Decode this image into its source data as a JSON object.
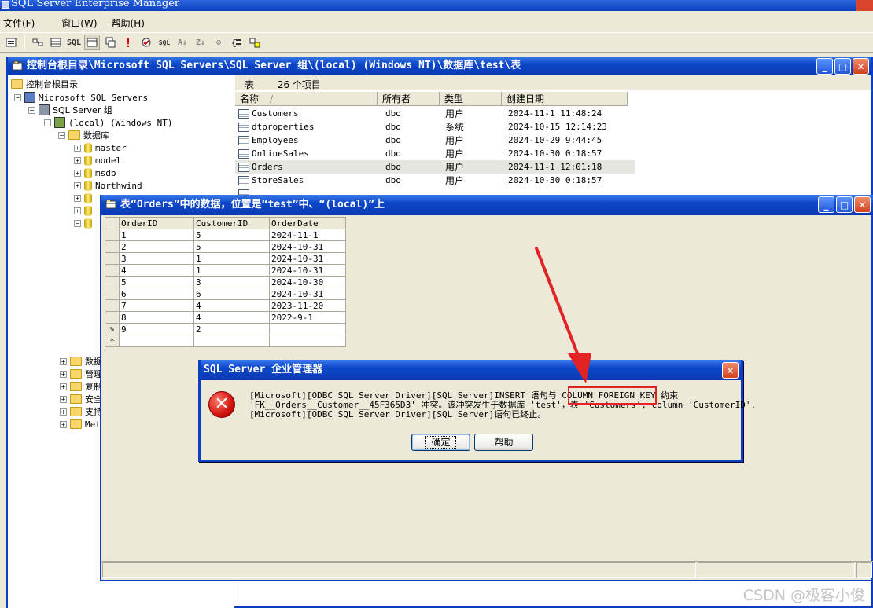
{
  "app": {
    "title": "SQL Server Enterprise Manager"
  },
  "menu": [
    "文件(F)",
    "窗口(W)",
    "帮助(H)"
  ],
  "console": {
    "title": "控制台根目录\\Microsoft SQL Servers\\SQL Server 组\\(local) (Windows NT)\\数据库\\test\\表"
  },
  "tree": {
    "root": "控制台根目录",
    "ms_servers": "Microsoft SQL Servers",
    "group": "SQL Server 组",
    "server": "(local) (Windows NT)",
    "databases": "数据库",
    "dbs": [
      "master",
      "model",
      "msdb",
      "Northwind"
    ],
    "more_folders": [
      "数据",
      "管理",
      "复制",
      "安全",
      "支持",
      "Met"
    ]
  },
  "list": {
    "summary_label": "表",
    "summary_count": "26 个项目",
    "columns": [
      "名称",
      "所有者",
      "类型",
      "创建日期"
    ],
    "rows": [
      {
        "name": "Customers",
        "owner": "dbo",
        "type": "用户",
        "created": "2024-11-1 11:48:24"
      },
      {
        "name": "dtproperties",
        "owner": "dbo",
        "type": "系统",
        "created": "2024-10-15 12:14:23"
      },
      {
        "name": "Employees",
        "owner": "dbo",
        "type": "用户",
        "created": "2024-10-29 9:44:45"
      },
      {
        "name": "OnlineSales",
        "owner": "dbo",
        "type": "用户",
        "created": "2024-10-30 0:18:57"
      },
      {
        "name": "Orders",
        "owner": "dbo",
        "type": "用户",
        "created": "2024-11-1 12:01:18"
      },
      {
        "name": "StoreSales",
        "owner": "dbo",
        "type": "用户",
        "created": "2024-10-30 0:18:57"
      }
    ]
  },
  "data_window": {
    "title": "表“Orders”中的数据，位置是“test”中、“(local)”上",
    "columns": [
      "OrderID",
      "CustomerID",
      "OrderDate"
    ],
    "rows": [
      [
        "1",
        "5",
        "2024-11-1"
      ],
      [
        "2",
        "5",
        "2024-10-31"
      ],
      [
        "3",
        "1",
        "2024-10-31"
      ],
      [
        "4",
        "1",
        "2024-10-31"
      ],
      [
        "5",
        "3",
        "2024-10-30"
      ],
      [
        "6",
        "6",
        "2024-10-31"
      ],
      [
        "7",
        "4",
        "2023-11-20"
      ],
      [
        "8",
        "4",
        "2022-9-1"
      ],
      [
        "9",
        "2",
        ""
      ]
    ],
    "new_row_marker": "*"
  },
  "error_dialog": {
    "title": "SQL Server 企业管理器",
    "line1": "[Microsoft][ODBC SQL Server Driver][SQL Server]INSERT 语句与 COLUMN FOREIGN KEY 约束",
    "line2": "'FK__Orders__Customer__45F365D3' 冲突。该冲突发生于数据库 'test'，表 'Customers', column 'CustomerID'.",
    "line3": "[Microsoft][ODBC SQL Server Driver][SQL Server]语句已终止。",
    "ok_label": "确定",
    "help_label": "帮助"
  },
  "watermark": "CSDN @极客小俊",
  "colors": {
    "titlebar": "#0b3fbf",
    "highlight_box": "#e32226",
    "arrow": "#e32226"
  }
}
